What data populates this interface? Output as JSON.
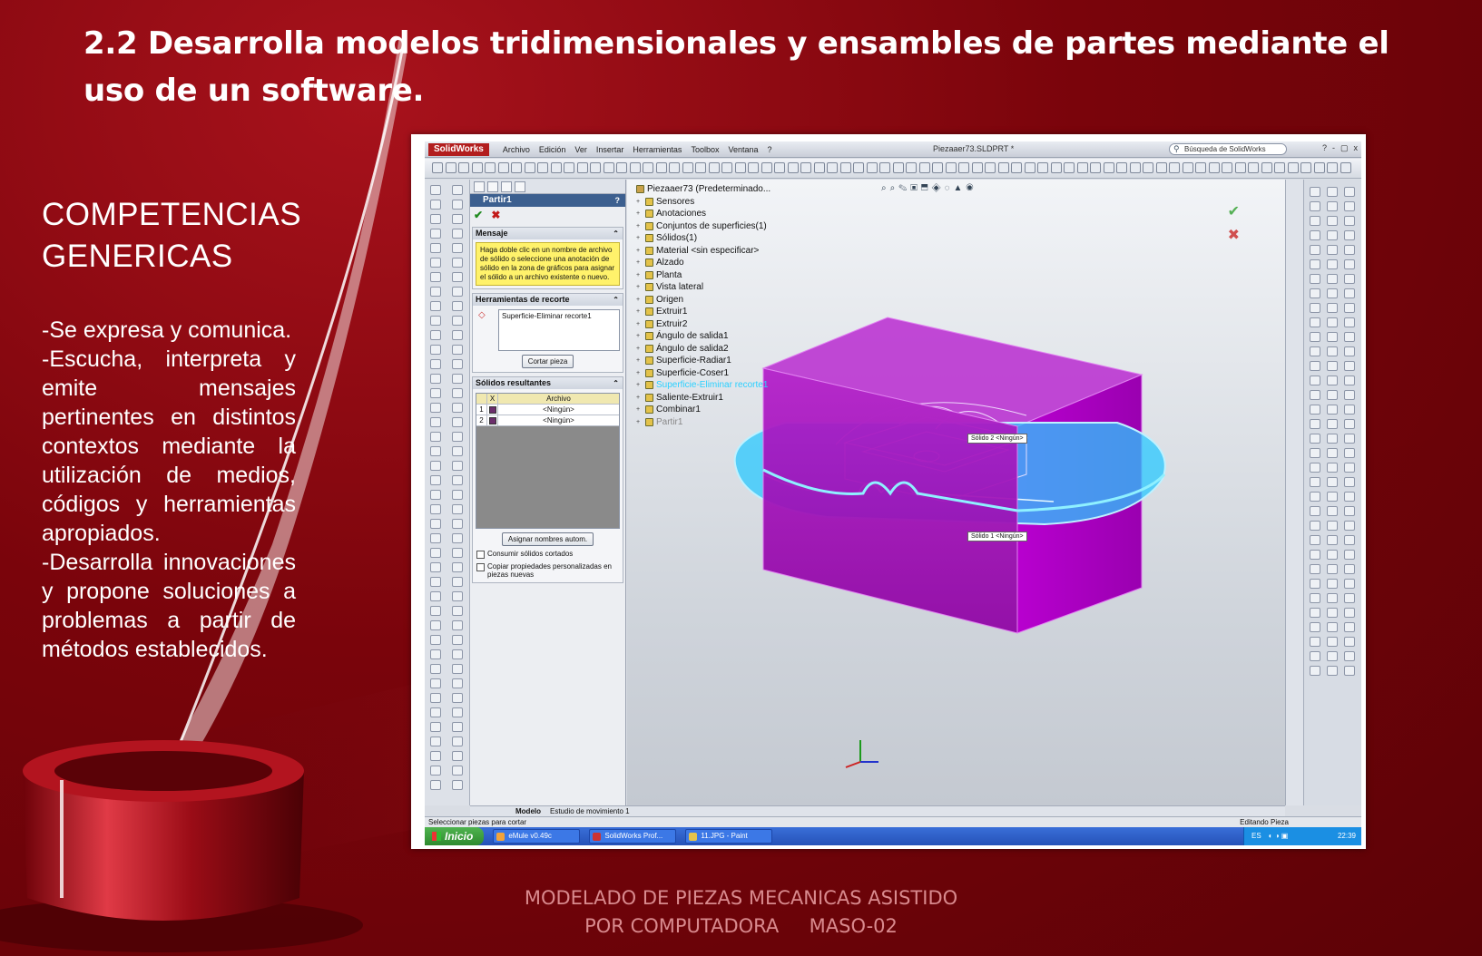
{
  "slide": {
    "title": "2.2 Desarrolla modelos tridimensionales y ensambles de partes mediante el uso de un software.",
    "competencias_heading": "COMPETENCIAS GENERICAS",
    "competencias": [
      "-Se expresa y comunica.",
      "-Escucha, interpreta y emite mensajes pertinentes en distintos contextos mediante la utilización de medios, códigos y herramientas apropiados.",
      "-Desarrolla innovaciones y propone soluciones a problemas a partir de métodos establecidos."
    ],
    "footer_line1": "MODELADO DE PIEZAS MECANICAS ASISTIDO",
    "footer_line2": "POR COMPUTADORA     MASO-02",
    "colors": {
      "background": "#7a040b",
      "accent": "#a8121c",
      "text": "#ffffff",
      "footer": "#d98a8e"
    }
  },
  "solidworks": {
    "app_name": "SolidWorks",
    "menu": [
      "Archivo",
      "Edición",
      "Ver",
      "Insertar",
      "Herramientas",
      "Toolbox",
      "Ventana",
      "?"
    ],
    "document_title": "Piezaaer73.SLDPRT *",
    "search_placeholder": "Búsqueda de SolidWorks",
    "window_controls": [
      "?",
      "-",
      "▢",
      "x"
    ],
    "property_manager": {
      "feature_name": "Partir1",
      "help": "?",
      "ok_glyph": "✔",
      "cancel_glyph": "✖",
      "mensaje_heading": "Mensaje",
      "mensaje_text": "Haga doble clic en un nombre de archivo de sólido o seleccione una anotación de sólido en la zona de gráficos para asignar el sólido a un archivo existente o nuevo.",
      "herramientas_heading": "Herramientas de recorte",
      "cut_item": "Superficie-Eliminar recorte1",
      "cortar_button": "Cortar pieza",
      "solidos_heading": "Sólidos resultantes",
      "table_header": [
        "",
        "X",
        "Archivo"
      ],
      "table_rows": [
        {
          "n": "1",
          "file": "<Ningún>"
        },
        {
          "n": "2",
          "file": "<Ningún>"
        }
      ],
      "asignar_button": "Asignar nombres autom.",
      "check_consumir": "Consumir sólidos cortados",
      "check_copiar": "Copiar propiedades personalizadas en piezas nuevas"
    },
    "feature_tree": {
      "root": "Piezaaer73  (Predeterminado...",
      "items": [
        {
          "label": "Sensores",
          "state": "normal"
        },
        {
          "label": "Anotaciones",
          "state": "normal"
        },
        {
          "label": "Conjuntos de superficies(1)",
          "state": "normal"
        },
        {
          "label": "Sólidos(1)",
          "state": "normal"
        },
        {
          "label": "Material <sin especificar>",
          "state": "normal"
        },
        {
          "label": "Alzado",
          "state": "normal"
        },
        {
          "label": "Planta",
          "state": "normal"
        },
        {
          "label": "Vista lateral",
          "state": "normal"
        },
        {
          "label": "Origen",
          "state": "normal"
        },
        {
          "label": "Extruir1",
          "state": "normal"
        },
        {
          "label": "Extruir2",
          "state": "normal"
        },
        {
          "label": "Ángulo de salida1",
          "state": "normal"
        },
        {
          "label": "Ángulo de salida2",
          "state": "normal"
        },
        {
          "label": "Superficie-Radiar1",
          "state": "normal"
        },
        {
          "label": "Superficie-Coser1",
          "state": "normal"
        },
        {
          "label": "Superficie-Eliminar recorte1",
          "state": "highlight"
        },
        {
          "label": "Saliente-Extruir1",
          "state": "normal"
        },
        {
          "label": "Combinar1",
          "state": "normal"
        },
        {
          "label": "Partir1",
          "state": "dim"
        }
      ]
    },
    "view_labels": {
      "solid2": "Sólido 2",
      "solid2_file": "<Ningún>",
      "solid1": "Sólido 1",
      "solid1_file": "<Ningún>"
    },
    "model_colors": {
      "block": "#a300b8",
      "block_dark": "#7d0090",
      "surface": "#29c8ff"
    },
    "tabs": [
      "Modelo",
      "Estudio de movimiento 1"
    ],
    "status_left": "Seleccionar piezas para cortar",
    "status_right": "Editando Pieza",
    "taskbar": {
      "start": "Inicio",
      "tasks": [
        "eMule v0.49c",
        "SolidWorks Prof...",
        "11.JPG - Paint"
      ],
      "lang": "ES",
      "clock": "22:39"
    }
  }
}
